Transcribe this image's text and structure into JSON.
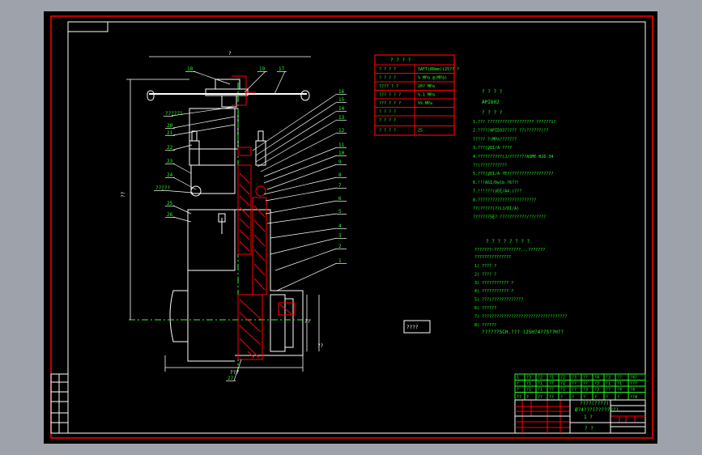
{
  "colors": {
    "background": "#9da2ab",
    "sheet": "#000000",
    "border": "#ff0000",
    "frame": "#ffffff",
    "text": "#22ff22"
  },
  "spec_table": {
    "title": "? ? ? ?",
    "rows": [
      {
        "label": "? ? ? ?",
        "value": "SAFT(Ø8mm)(25?? ?"
      },
      {
        "label": "? ? ? ?",
        "value": "% MPa @(MPa)"
      },
      {
        "label": "???? ? ?",
        "value": "20? MPa"
      },
      {
        "label": "??? ? ? ?",
        "value": "%.1 MPa"
      },
      {
        "label": "??? ? ? ?",
        "value": "%% MPa"
      },
      {
        "label": "? ? ? ?",
        "value": ""
      },
      {
        "label": "? ? ? ?",
        "value": ""
      },
      {
        "label": "? ? ? ?",
        "value": "25"
      }
    ]
  },
  "notes": {
    "heading1": "? ? ? ?",
    "standard": "API602",
    "heading2": "? ? ? ?",
    "lines": [
      "1.???  ???????????????????      ??????1?",
      "2.?????APIE03????? ??(??????)??",
      "  ?????   ?(MPa???????",
      "3.???(ÿDI/A ????",
      "4.??????????(J/???????ASME B16.34",
      "  ??(???????????",
      "5.???(ÿDI/A ?E???????????????????",
      "6.!!!ASI/Dwlb ?6??!",
      "7.!!!???(ÿDI/A4.)???",
      "8.????????????????????????",
      "  ??(?????(??(J/DI/A)",
      "  ???????5E?   ???????????/??/????"
    ],
    "heading3": "? ? ? ? ? ? ? ?",
    "para": [
      "???????~???????????...???????",
      "???????????????"
    ],
    "items": [
      "1) ????  ?",
      "2) ????   ?",
      "3) ???????????         ?",
      "4) ???????????         ?",
      "5) ???(?????????????",
      "6) ??????",
      "7) ???????????????????????????????????",
      "8) ??????"
    ],
    "footer": "??????SCH.???  (25H?4??5??H??"
  },
  "stamp_box": "????",
  "part_labels": [
    "18",
    "19",
    "17",
    "?????1",
    "20",
    "21",
    "22",
    "23",
    "24",
    "?????",
    "25",
    "26",
    "16",
    "15",
    "14",
    "13",
    "12",
    "11",
    "10",
    "9",
    "8",
    "7",
    "6",
    "5",
    "4",
    "3",
    "2",
    "1",
    "27"
  ],
  "dim_labels": {
    "top": "?",
    "height": "??",
    "bottom": "???",
    "bore": "??",
    "right": "??"
  },
  "title_block": {
    "grid": [
      [
        "1",
        "?3",
        "?2",
        "?1",
        "?2",
        "?3",
        "??",
        "?4",
        "?3",
        "??",
        "?4?"
      ],
      [
        "?",
        "?1",
        "?1",
        "??",
        "?1",
        "??",
        "??",
        "?3",
        "?1",
        "?1",
        "???"
      ],
      [
        "?",
        "?1",
        "?1",
        "??",
        "?1",
        "??",
        "?3",
        "?3",
        "??",
        "?4",
        "?4"
      ],
      [
        "??",
        "?",
        "??",
        "??",
        "?",
        "?",
        "?",
        "?",
        "?",
        "?",
        "??4"
      ]
    ],
    "drawing_name": "????(????)",
    "drawing_code": "Ø?4???(???????)",
    "scale": "1  ?",
    "company": "? ?"
  }
}
